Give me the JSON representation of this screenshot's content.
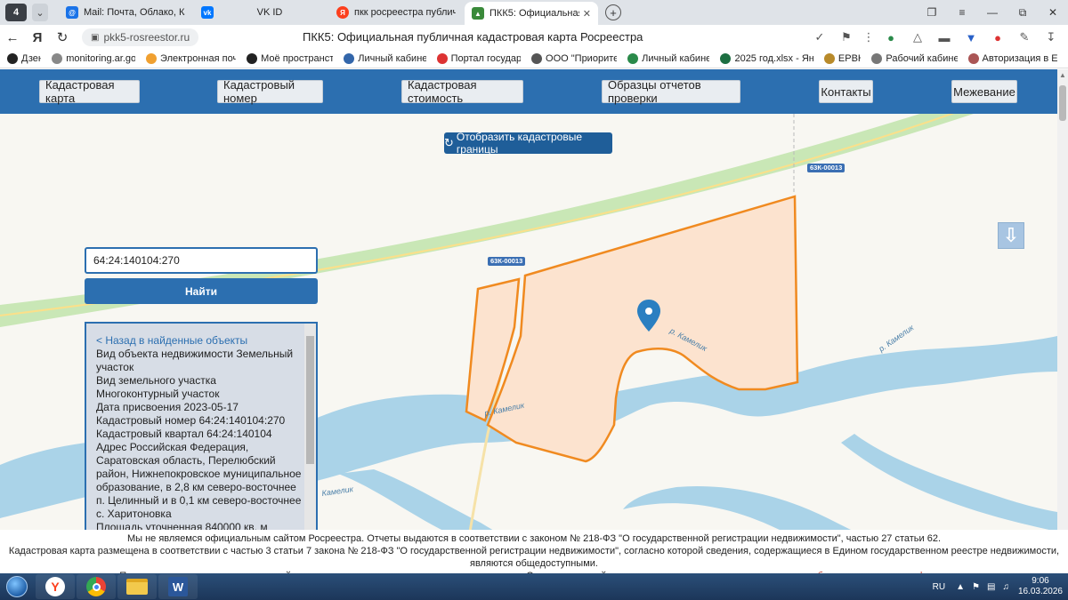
{
  "browser": {
    "tab_counter": "4",
    "tabs": [
      {
        "title": "Mail: Почта, Облако, Кале",
        "icon": "mail-icon",
        "color": "#1a73e8"
      },
      {
        "title": "VK ID",
        "icon": "vk-icon",
        "color": "#0077ff"
      },
      {
        "title": "пкк росреестра публичн",
        "icon": "yandex-icon",
        "color": "#fc3f1d"
      },
      {
        "title": "ПКК5: Официальная пу",
        "icon": "pkk-icon",
        "color": "#3a8a3a",
        "active": true
      }
    ],
    "url": "pkk5-rosreestor.ru",
    "page_title": "ПКК5: Официальная публичная кадастровая карта Росреестра",
    "bookmarks": [
      {
        "label": "Дзен",
        "color": "#222"
      },
      {
        "label": "monitoring.ar.gov",
        "color": "#888"
      },
      {
        "label": "Электронная почт",
        "color": "#f0a030"
      },
      {
        "label": "Моё пространств",
        "color": "#222"
      },
      {
        "label": "Личный кабинет",
        "color": "#3366aa"
      },
      {
        "label": "Портал государс",
        "color": "#d33"
      },
      {
        "label": "ООО \"Приоритет",
        "color": "#555"
      },
      {
        "label": "Личный кабинет",
        "color": "#2a8a4a"
      },
      {
        "label": "2025 год.xlsx - Янд",
        "color": "#1d6f42"
      },
      {
        "label": "ЕРВК",
        "color": "#b88a2a"
      },
      {
        "label": "Рабочий кабинет",
        "color": "#777"
      },
      {
        "label": "Авторизация в Ед",
        "color": "#a55"
      }
    ]
  },
  "nav": {
    "items": [
      "Кадастровая карта",
      "Кадастровый номер",
      "Кадастровая стоимость",
      "Образцы отчетов проверки",
      "Контакты",
      "Межевание"
    ]
  },
  "map": {
    "show_borders_label": "Отобразить кадастровые границы",
    "road_labels": [
      "63К-00013",
      "63К-00013"
    ],
    "river_labels": [
      "р. Камелик",
      "р. Камелик",
      "р. Камелик",
      "Камелик"
    ],
    "colors": {
      "parcel_fill": "#fce3cf",
      "parcel_stroke": "#f08a20",
      "water": "#aad3e8",
      "road_green": "#c9e7b6",
      "marker": "#2a7fc1"
    }
  },
  "search": {
    "value": "64:24:140104:270",
    "button_label": "Найти"
  },
  "info": {
    "back_link": "< Назад в найденные объекты",
    "lines": [
      "Вид объекта недвижимости Земельный участок",
      "Вид земельного участка Многоконтурный участок",
      "Дата присвоения 2023-05-17",
      "Кадастровый номер 64:24:140104:270",
      "Кадастровый квартал 64:24:140104",
      "Адрес Российская Федерация, Саратовская область, Перелюбский район, Нижнепокровское муниципальное образование, в 2,8 км северо-восточнее п. Целинный и в 0,1 км северо-восточнее с. Харитоновка",
      "Площадь уточненная 840000 кв. м"
    ]
  },
  "disclaimer": {
    "line1": "Мы не являемся официальным сайтом Росреестра. Отчеты выдаются в соответствии с законом № 218-ФЗ \"О государственной регистрации недвижимости\", частью 27 статьи 62.",
    "line2": "Кадастровая карта размещена в соответствии с частью 3 статьи 7 закона № 218-ФЗ \"О государственной регистрации недвижимости\", согласно которой сведения, содержащиеся в Едином государственном реестре недвижимости, являются общедоступными.",
    "line3_a": "Плата за использование кадастровой карты не взимается, оплачиваются только отчеты. Оставаясь на сайте, вы соглашаетесь, что вами просмотрены ",
    "line3_link1": "образцы",
    "line3_b": " и прочитана ",
    "line3_link2": "оферта",
    "line3_c": "."
  },
  "taskbar": {
    "lang": "RU",
    "time": "9:06",
    "date": "16.03.2026"
  }
}
